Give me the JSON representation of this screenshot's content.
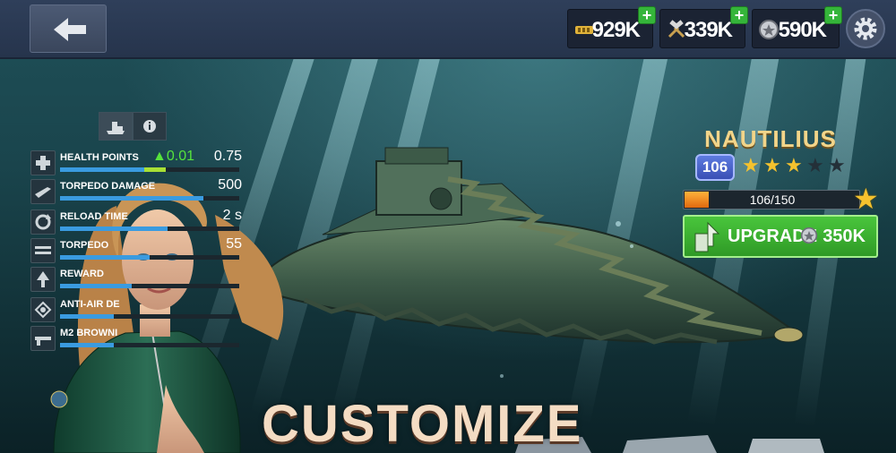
{
  "header": {
    "back_icon": "arrow-left-icon",
    "resources": [
      {
        "icon": "ammo-icon",
        "value": "929K",
        "plus": "+"
      },
      {
        "icon": "tools-icon",
        "value": "339K",
        "plus": "+"
      },
      {
        "icon": "silver-coin-icon",
        "value": "590K",
        "plus": "+"
      }
    ],
    "settings_icon": "gear-icon"
  },
  "stats_panel": {
    "tabs": [
      {
        "icon": "ship-icon",
        "active": true
      },
      {
        "icon": "info-icon",
        "active": false
      }
    ],
    "stats": [
      {
        "icon": "health-cross-icon",
        "label": "HEALTH POINTS",
        "delta": "0.01",
        "value": "0.75",
        "fill": 0.47,
        "bonus": 0.12
      },
      {
        "icon": "torpedo-icon",
        "label": "TORPEDO DAMAGE",
        "value": "500",
        "fill": 0.8
      },
      {
        "icon": "reload-icon",
        "label": "RELOAD TIME",
        "value": "2 s",
        "fill": 0.6
      },
      {
        "icon": "torpedo-launcher-icon",
        "label": "TORPEDO",
        "value": "55",
        "fill": 0.5
      },
      {
        "icon": "reward-icon",
        "label": "REWARD",
        "value": "",
        "fill": 0.4
      },
      {
        "icon": "anti-air-icon",
        "label": "ANTI-AIR DE",
        "value": "",
        "fill": 0.3
      },
      {
        "icon": "machine-gun-icon",
        "label": "M2 BROWNI",
        "value": "",
        "fill": 0.3
      }
    ]
  },
  "ship": {
    "name": "NAUTILIUS",
    "level": "106",
    "stars_filled": 3,
    "stars_total": 5,
    "xp_text": "106/150",
    "xp_fraction": 0.14,
    "upgrade_label": "UPGRADE",
    "upgrade_cost": "350K",
    "upgrade_cost_icon": "silver-coin-icon"
  },
  "banner": {
    "text": "CUSTOMIZE"
  },
  "colors": {
    "accent_green": "#35b53a",
    "gold": "#f2d58a",
    "xp_orange": "#f08a1e"
  }
}
